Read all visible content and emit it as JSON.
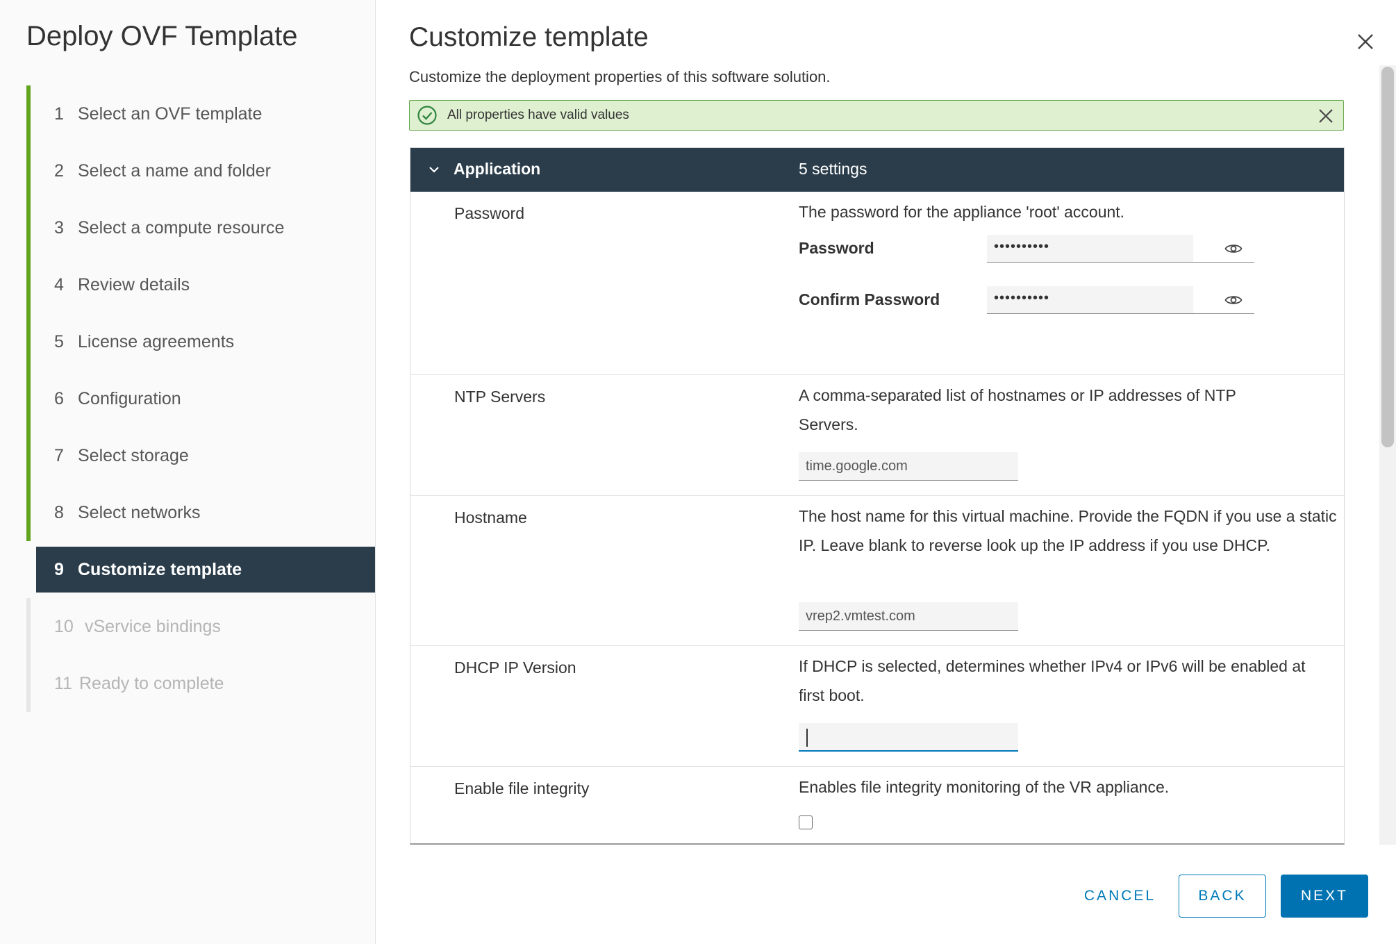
{
  "wizard": {
    "title": "Deploy OVF Template",
    "steps": [
      {
        "num": "1",
        "label": "Select an OVF template",
        "state": "done"
      },
      {
        "num": "2",
        "label": "Select a name and folder",
        "state": "done"
      },
      {
        "num": "3",
        "label": "Select a compute resource",
        "state": "done"
      },
      {
        "num": "4",
        "label": "Review details",
        "state": "done"
      },
      {
        "num": "5",
        "label": "License agreements",
        "state": "done"
      },
      {
        "num": "6",
        "label": "Configuration",
        "state": "done"
      },
      {
        "num": "7",
        "label": "Select storage",
        "state": "done"
      },
      {
        "num": "8",
        "label": "Select networks",
        "state": "done"
      },
      {
        "num": "9",
        "label": "Customize template",
        "state": "active"
      },
      {
        "num": "10",
        "label": "vService bindings",
        "state": "upcoming"
      },
      {
        "num": "11",
        "label": "Ready to complete",
        "state": "upcoming"
      }
    ]
  },
  "main": {
    "title": "Customize template",
    "subtitle": "Customize the deployment properties of this software solution.",
    "alert": {
      "text": "All properties have valid values",
      "status": "success"
    },
    "group": {
      "name": "Application",
      "count": "5 settings",
      "expanded": true
    },
    "properties": {
      "password": {
        "label": "Password",
        "description": "The password for the appliance 'root' account.",
        "password_label": "Password",
        "password_value": "••••••••••",
        "confirm_label": "Confirm Password",
        "confirm_value": "••••••••••"
      },
      "ntp": {
        "label": "NTP Servers",
        "description": "A comma-separated list of hostnames or IP addresses of NTP Servers.",
        "value": "time.google.com"
      },
      "hostname": {
        "label": "Hostname",
        "description": "The host name for this virtual machine. Provide the FQDN if you use a static IP. Leave blank to reverse look up the IP address if you use DHCP.",
        "value": "vrep2.vmtest.com"
      },
      "dhcp": {
        "label": "DHCP IP Version",
        "description": "If DHCP is selected, determines whether IPv4 or IPv6 will be enabled at first boot.",
        "value": ""
      },
      "integrity": {
        "label": "Enable file integrity",
        "description": "Enables file integrity monitoring of the VR appliance.",
        "checked": false
      }
    }
  },
  "footer": {
    "cancel_label": "CANCEL",
    "back_label": "BACK",
    "next_label": "NEXT"
  },
  "colors": {
    "accent": "#0079b8",
    "done": "#62a420",
    "header": "#2b3d4b",
    "success_bg": "#dff0d0"
  }
}
